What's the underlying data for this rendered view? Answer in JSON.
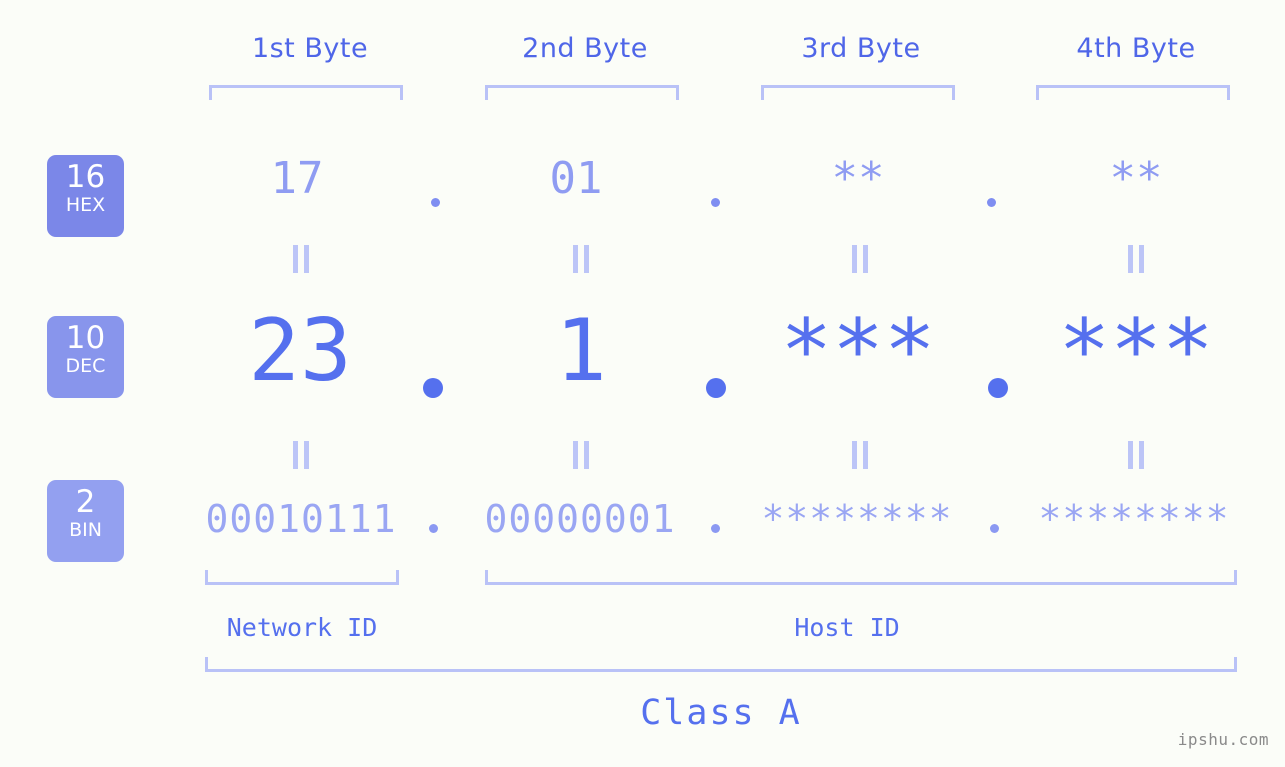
{
  "header": {
    "byte_labels": [
      "1st Byte",
      "2nd Byte",
      "3rd Byte",
      "4th Byte"
    ]
  },
  "radix_badges": [
    {
      "number": "16",
      "name": "HEX",
      "color": "#7b87e8"
    },
    {
      "number": "10",
      "name": "DEC",
      "color": "#8895ec"
    },
    {
      "number": "2",
      "name": "BIN",
      "color": "#93a0f0"
    }
  ],
  "rows": {
    "hex": {
      "values": [
        "17",
        "01",
        "**",
        "**"
      ],
      "separator": "."
    },
    "dec": {
      "values": [
        "23",
        "1",
        "***",
        "***"
      ],
      "separator": "."
    },
    "bin": {
      "values": [
        "00010111",
        "00000001",
        "********",
        "********"
      ],
      "separator": "."
    }
  },
  "connectors": {
    "symbol": "||",
    "rows": 2
  },
  "footer": {
    "network_id_label": "Network ID",
    "host_id_label": "Host ID",
    "class_label": "Class A"
  },
  "watermark": "ipshu.com",
  "colors": {
    "background": "#fbfdf8",
    "accent": "#5570ee",
    "accent_light": "#b9c2f7",
    "hex_text": "#8f9cf2",
    "bin_text": "#9aa6f3",
    "watermark": "#8a8a8a"
  }
}
